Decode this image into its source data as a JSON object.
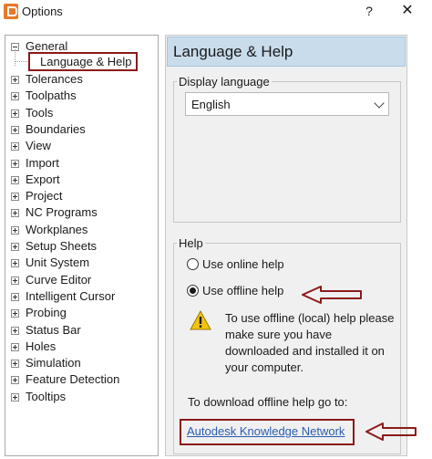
{
  "window": {
    "title": "Options",
    "help_glyph": "?",
    "close_glyph": "✕"
  },
  "tree": {
    "general": "General",
    "language_help": "Language & Help",
    "items": [
      "Tolerances",
      "Toolpaths",
      "Tools",
      "Boundaries",
      "View",
      "Import",
      "Export",
      "Project",
      "NC Programs",
      "Workplanes",
      "Setup Sheets",
      "Unit System",
      "Curve Editor",
      "Intelligent Cursor",
      "Probing",
      "Status Bar",
      "Holes",
      "Simulation",
      "Feature Detection",
      "Tooltips"
    ]
  },
  "panel": {
    "title": "Language & Help"
  },
  "display_language": {
    "label": "Display language",
    "selected": "English"
  },
  "help": {
    "label": "Help",
    "online_label": "Use online help",
    "offline_label": "Use offline help",
    "warning_text": "To use offline (local) help please make sure you have downloaded and installed it on your computer.",
    "download_label": "To download offline help go to:",
    "link_text": "Autodesk Knowledge Network"
  },
  "colors": {
    "annotation": "#8b1a1a",
    "header": "#c9dcec",
    "link": "#2a5db0",
    "warning": "#f2c40f"
  }
}
